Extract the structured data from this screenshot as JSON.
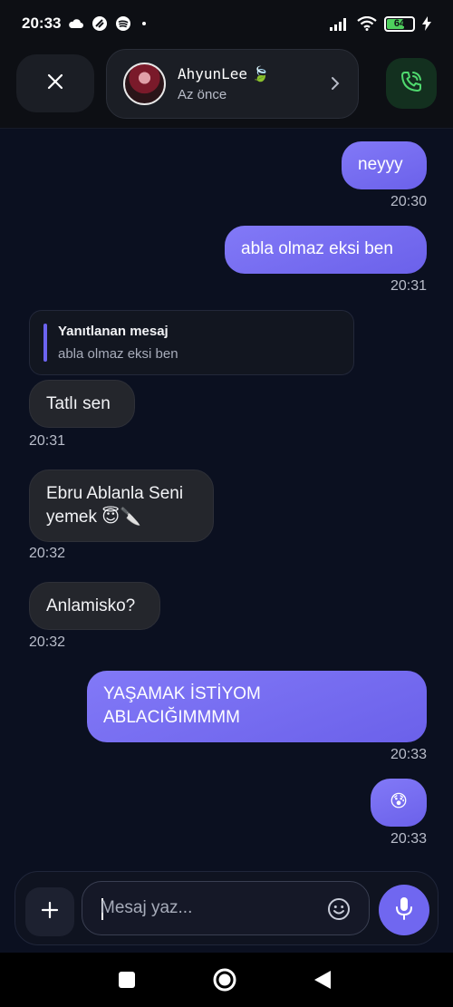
{
  "status_bar": {
    "time": "20:33",
    "battery": "64",
    "icons": [
      "cloud-icon",
      "swirl-icon",
      "spotify-icon",
      "dot-icon",
      "signal-icon",
      "wifi-icon",
      "battery-icon",
      "charging-icon"
    ]
  },
  "header": {
    "contact_name": "AhyunLee",
    "contact_emoji": "🍃",
    "contact_status": "Az önce",
    "icons": [
      "close-icon",
      "chevron-right-icon",
      "phone-icon"
    ],
    "call_color": "#4fd96e"
  },
  "reply": {
    "title": "Yanıtlanan mesaj",
    "text": "abla olmaz eksi ben"
  },
  "messages": [
    {
      "dir": "out",
      "text": "neyyy",
      "time": "20:30"
    },
    {
      "dir": "out",
      "text": "abla olmaz eksi ben",
      "time": "20:31"
    },
    {
      "dir": "in",
      "text": "Tatlı sen",
      "time": "20:31"
    },
    {
      "dir": "in",
      "text": "Ebru Ablanla Seni\nyemek 😇🔪",
      "time": "20:32"
    },
    {
      "dir": "in",
      "text": "Anlamisko?",
      "time": "20:32"
    },
    {
      "dir": "out",
      "text": "YAŞAMAK İSTİYOM\nABLACIĞIMMMM",
      "time": "20:33"
    },
    {
      "dir": "out",
      "text": "😰",
      "time": "20:33"
    }
  ],
  "composer": {
    "placeholder": "Mesaj yaz...",
    "icons": [
      "plus-icon",
      "emoji-icon",
      "mic-icon"
    ]
  },
  "nav": {
    "icons": [
      "recents-icon",
      "home-icon",
      "back-icon"
    ]
  },
  "colors": {
    "accent": "#7067f0",
    "background": "#0b1020",
    "incoming_bubble": "#24262c"
  }
}
